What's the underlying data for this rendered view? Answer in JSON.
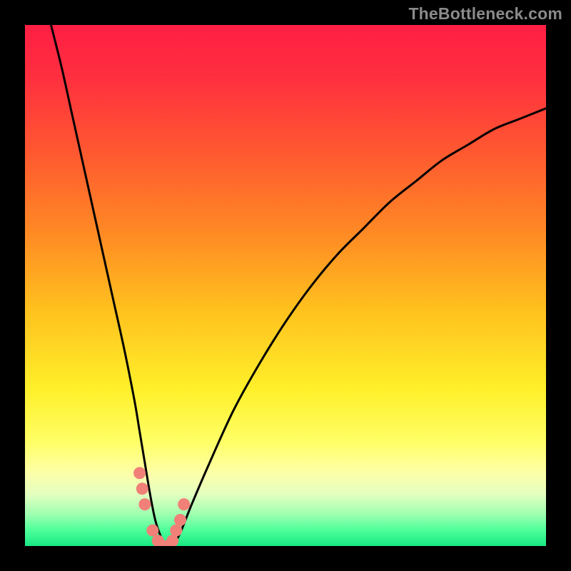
{
  "watermark": "TheBottleneck.com",
  "gradient_stops": [
    {
      "offset": 0.0,
      "color": "#ff1f44"
    },
    {
      "offset": 0.1,
      "color": "#ff2f3f"
    },
    {
      "offset": 0.25,
      "color": "#ff5a30"
    },
    {
      "offset": 0.4,
      "color": "#ff8a24"
    },
    {
      "offset": 0.55,
      "color": "#ffc21e"
    },
    {
      "offset": 0.7,
      "color": "#fff02a"
    },
    {
      "offset": 0.8,
      "color": "#ffff66"
    },
    {
      "offset": 0.86,
      "color": "#fdffa8"
    },
    {
      "offset": 0.9,
      "color": "#e4ffc0"
    },
    {
      "offset": 0.94,
      "color": "#9cffb0"
    },
    {
      "offset": 0.97,
      "color": "#4dff9a"
    },
    {
      "offset": 1.0,
      "color": "#18e884"
    }
  ],
  "chart_data": {
    "type": "line",
    "title": "",
    "xlabel": "",
    "ylabel": "",
    "xlim": [
      0,
      100
    ],
    "ylim": [
      0,
      100
    ],
    "grid": false,
    "legend": false,
    "series": [
      {
        "name": "bottleneck-curve",
        "color": "#000000",
        "x": [
          5,
          7,
          9,
          11,
          13,
          15,
          17,
          19,
          21,
          22,
          23,
          24,
          25,
          26,
          27,
          28,
          29,
          30,
          32,
          35,
          40,
          45,
          50,
          55,
          60,
          65,
          70,
          75,
          80,
          85,
          90,
          95,
          100
        ],
        "y": [
          100,
          92,
          83,
          74,
          65,
          56,
          47,
          38,
          28,
          22,
          16,
          10,
          5,
          2,
          0,
          0,
          1,
          3,
          8,
          15,
          26,
          35,
          43,
          50,
          56,
          61,
          66,
          70,
          74,
          77,
          80,
          82,
          84
        ]
      },
      {
        "name": "highlight-dots",
        "color": "#f08078",
        "x": [
          22.0,
          22.5,
          23.0,
          24.5,
          25.5,
          26.5,
          27.5,
          28.3,
          29.0,
          29.8,
          30.5
        ],
        "y": [
          14,
          11,
          8,
          3,
          1,
          0,
          0,
          1,
          3,
          5,
          8
        ]
      }
    ]
  }
}
